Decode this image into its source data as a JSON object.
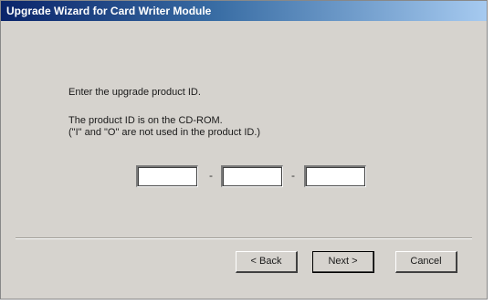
{
  "window": {
    "title": "Upgrade Wizard for Card Writer Module"
  },
  "body": {
    "instruction": "Enter the upgrade product ID.",
    "hint_line1": "The product ID is on the CD-ROM.",
    "hint_line2": "(\"I\" and \"O\" are not used in the product ID.)"
  },
  "product_id": {
    "fields": [
      {
        "value": ""
      },
      {
        "value": ""
      },
      {
        "value": ""
      }
    ],
    "separator": "-"
  },
  "buttons": {
    "back": "< Back",
    "next": "Next >",
    "cancel": "Cancel"
  }
}
